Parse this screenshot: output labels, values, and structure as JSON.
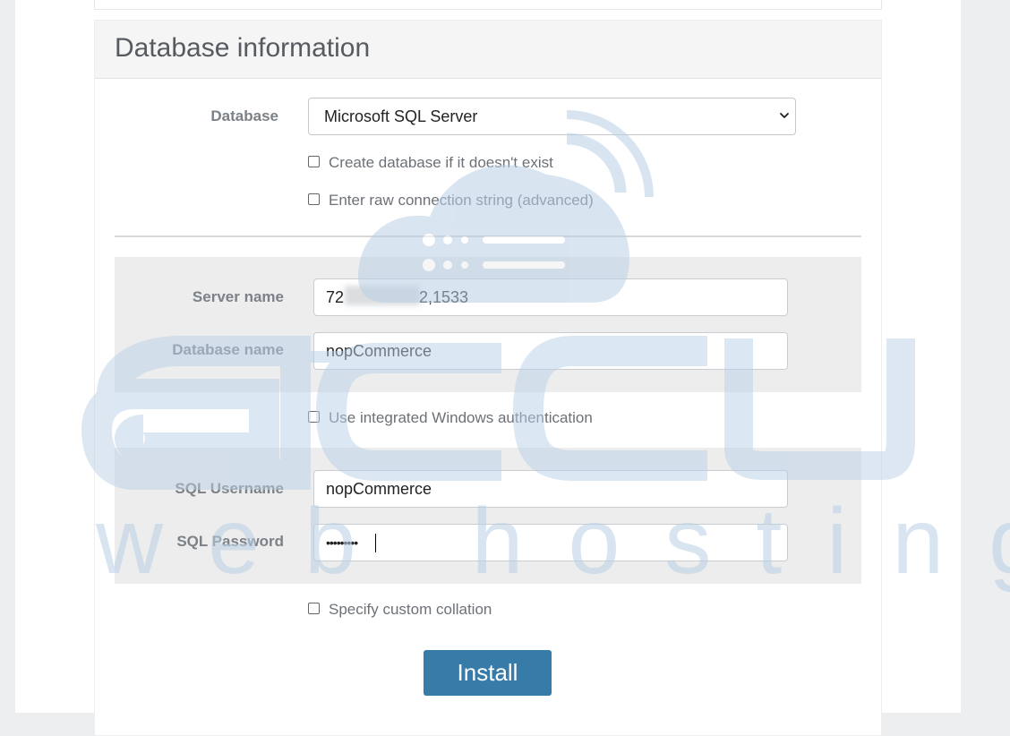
{
  "section": {
    "title": "Database information"
  },
  "database": {
    "label": "Database",
    "selected": "Microsoft SQL Server",
    "options": {
      "create_db": "Create database if it doesn't exist",
      "raw_conn": "Enter raw connection string (advanced)"
    }
  },
  "connection": {
    "server_label": "Server name",
    "server_value_start": "72",
    "server_value_end": "2,1533",
    "dbname_label": "Database name",
    "dbname_value": "nopCommerce",
    "integrated_auth": "Use integrated Windows authentication",
    "username_label": "SQL Username",
    "username_value": "nopCommerce",
    "password_label": "SQL Password",
    "password_value": "•••••••••"
  },
  "collation": "Specify custom collation",
  "install_label": "Install",
  "watermark": {
    "brand": "accu",
    "tagline": "web hosting",
    "color": "#b9d0e6"
  }
}
